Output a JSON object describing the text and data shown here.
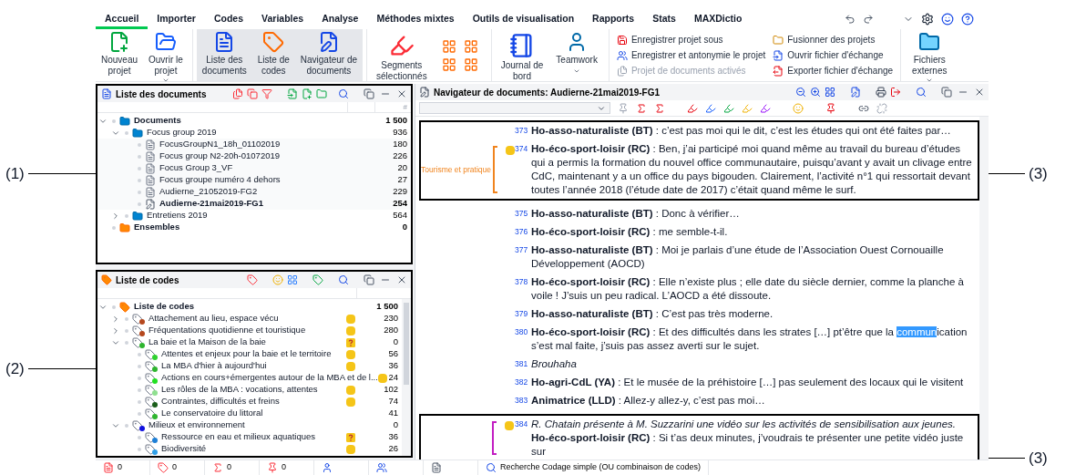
{
  "annotations": {
    "left": [
      {
        "label": "(1)"
      },
      {
        "label": "(2)"
      }
    ],
    "right": [
      {
        "label": "(3)"
      },
      {
        "label": "(3)"
      }
    ]
  },
  "tabs": [
    {
      "label": "Accueil",
      "selected": true
    },
    {
      "label": "Importer",
      "selected": false
    },
    {
      "label": "Codes",
      "selected": false
    },
    {
      "label": "Variables",
      "selected": false
    },
    {
      "label": "Analyse",
      "selected": false
    },
    {
      "label": "Méthodes mixtes",
      "selected": false
    },
    {
      "label": "Outils de visualisation",
      "selected": false
    },
    {
      "label": "Rapports",
      "selected": false
    },
    {
      "label": "Stats",
      "selected": false
    },
    {
      "label": "MAXDictio",
      "selected": false
    }
  ],
  "ribbon": {
    "project_buttons": [
      {
        "kind": "new",
        "lines": [
          "Nouveau",
          "projet"
        ]
      },
      {
        "kind": "open",
        "lines": [
          "Ouvrir le",
          "projet"
        ],
        "menu": true
      }
    ],
    "panel_buttons": [
      {
        "kind": "documents",
        "lines": [
          "Liste des",
          "documents"
        ],
        "selected": true
      },
      {
        "kind": "codes",
        "lines": [
          "Liste de",
          "codes"
        ],
        "selected": true
      },
      {
        "kind": "navigator",
        "lines": [
          "Navigateur de",
          "documents"
        ],
        "selected": true
      }
    ],
    "segments_button": {
      "lines": [
        "Segments",
        "sélectionnés"
      ]
    },
    "journal_button": {
      "lines": [
        "Journal de",
        "bord"
      ]
    },
    "teamwork_button": {
      "lines": [
        "Teamwork"
      ],
      "menu": true
    },
    "action_columns": [
      [
        {
          "kind": "save-as",
          "label": "Enregistrer projet sous",
          "disabled": false
        },
        {
          "kind": "anonymize",
          "label": "Enregistrer et antonymie le projet",
          "disabled": false
        },
        {
          "kind": "activated",
          "label": "Projet de documents activés",
          "disabled": true
        }
      ],
      [
        {
          "kind": "merge",
          "label": "Fusionner des projets",
          "disabled": false
        },
        {
          "kind": "open-exchange",
          "label": "Ouvrir fichier d'échange",
          "disabled": false
        },
        {
          "kind": "export",
          "label": "Exporter fichier d'échange",
          "disabled": false
        }
      ]
    ],
    "external_button": {
      "lines": [
        "Fichiers",
        "externes"
      ],
      "menu": true
    }
  },
  "documents_panel": {
    "title": "Liste des documents",
    "count_header": "#",
    "tree": [
      {
        "kind": "folder",
        "label": "Documents",
        "count": "1 500",
        "expanded": true,
        "children": [
          {
            "kind": "folder",
            "label": "Focus group 2019",
            "count": "936",
            "expanded": true,
            "children": [
              {
                "kind": "document",
                "label": "FocusGroupN1_18h_01102019",
                "count": "180",
                "active": false
              },
              {
                "kind": "document",
                "label": "Focus group N2-20h-01072019",
                "count": "226",
                "active": false
              },
              {
                "kind": "document",
                "label": "Focus Group 3_VF",
                "count": "20",
                "active": false
              },
              {
                "kind": "document",
                "label": "Focus groupe numéro 4 dehors",
                "count": "27",
                "active": false
              },
              {
                "kind": "document",
                "label": "Audierne_21052019-FG2",
                "count": "229",
                "active": false
              },
              {
                "kind": "document",
                "label": "Audierne-21mai2019-FG1",
                "count": "254",
                "active": true
              }
            ]
          },
          {
            "kind": "folder",
            "label": "Entretiens 2019",
            "count": "564",
            "expanded": false
          }
        ]
      },
      {
        "kind": "set",
        "label": "Ensembles",
        "count": "0"
      }
    ]
  },
  "codes_panel": {
    "title": "Liste de codes",
    "tree": [
      {
        "kind": "root",
        "label": "Liste de codes",
        "count": "1 500",
        "expanded": true,
        "children": [
          {
            "label": "Attachement au lieu, espace vécu",
            "count": "230",
            "color": "#b5481e",
            "memo": true,
            "question": false,
            "expanded": false
          },
          {
            "label": "Fréquentations quotidienne et touristique",
            "count": "280",
            "color": "#b5481e",
            "memo": true,
            "question": false,
            "expanded": false
          },
          {
            "label": "La baie et la Maison de la baie",
            "count": "0",
            "color": "#2fb52f",
            "memo": true,
            "question": true,
            "expanded": true,
            "children": [
              {
                "label": "Attentes et enjeux pour la baie et le territoire",
                "count": "56",
                "color": "#2fd12f",
                "memo": true,
                "question": false
              },
              {
                "label": "La MBA d'hier à aujourd'hui",
                "count": "36",
                "color": "#2fb52f",
                "memo": true,
                "question": false
              },
              {
                "label": "Actions en cours+émergentes autour de la MBA et de l...",
                "count": "24",
                "color": "#22e022",
                "memo": true,
                "question": false
              },
              {
                "label": "Les rôles de la MBA : vocations, attentes",
                "count": "102",
                "color": "#8fe08f",
                "memo": true,
                "question": false
              },
              {
                "label": "Contraintes, difficultés et freins",
                "count": "74",
                "color": "#1a5e1a",
                "memo": true,
                "question": false
              },
              {
                "label": "Le conservatoire du littoral",
                "count": "41",
                "color": "#2fb52f",
                "memo": false
              }
            ]
          },
          {
            "label": "Milieux et environnement",
            "count": "0",
            "color": "#1010e0",
            "memo": false,
            "expanded": true,
            "children": [
              {
                "label": "Ressource en eau et milieux aquatiques",
                "count": "36",
                "color": "#1e7fd6",
                "memo": true,
                "question": true
              },
              {
                "label": "Biodiversité",
                "count": "26",
                "color": "#2f9fe8",
                "memo": true,
                "question": false
              }
            ]
          }
        ]
      }
    ]
  },
  "navigator": {
    "title": "Navigateur de documents: Audierne-21mai2019-FG1",
    "blocks": [
      {
        "boxed": true,
        "paragraphs": [
          {
            "number": "373",
            "parts": [
              {
                "kind": "bold",
                "text": "Ho-asso-naturaliste (BT)"
              },
              {
                "kind": "plain",
                "text": " : c’est pas moi qui le dit, c’est les études qui ont été faites par…"
              }
            ]
          },
          {
            "number": "374",
            "memo": true,
            "coding": {
              "label": "Tourisme et pratique",
              "color": "#f0841e"
            },
            "parts": [
              {
                "kind": "bold",
                "text": "Ho-éco-sport-loisir (RC)"
              },
              {
                "kind": "plain",
                "text": " : Ben, j’ai participé moi quand même au travail du bureau d’études qui a permis la formation du nouvel office communautaire, puisqu’avant y avait un clivage entre CdC, maintenant y a un office du pays bigouden. Clairement, l’activité n°1 qui ressortait devant toutes l’année 2018 (l’étude date de 2017) c’était quand même le surf."
              }
            ]
          }
        ]
      },
      {
        "boxed": false,
        "paragraphs": [
          {
            "number": "375",
            "parts": [
              {
                "kind": "bold",
                "text": "Ho-asso-naturaliste (BT)"
              },
              {
                "kind": "plain",
                "text": " : Donc à vérifier…"
              }
            ]
          },
          {
            "number": "376",
            "parts": [
              {
                "kind": "bold",
                "text": "Ho-éco-sport-loisir (RC)"
              },
              {
                "kind": "plain",
                "text": " : me semble-t-il."
              }
            ]
          },
          {
            "number": "377",
            "parts": [
              {
                "kind": "bold",
                "text": "Ho-asso-naturaliste (BT)"
              },
              {
                "kind": "plain",
                "text": " : Moi je parlais d’une étude de l’Association Ouest Cornouaille Développement (AOCD)"
              }
            ]
          },
          {
            "number": "378",
            "parts": [
              {
                "kind": "bold",
                "text": "Ho-éco-sport-loisir (RC)"
              },
              {
                "kind": "plain",
                "text": " : Elle n’existe plus ; elle date du siècle dernier, comme la planche à voile ! J’suis un peu radical.  L’AOCD a été dissoute."
              }
            ]
          },
          {
            "number": "379",
            "parts": [
              {
                "kind": "bold",
                "text": "Ho-asso-naturaliste (BT)"
              },
              {
                "kind": "plain",
                "text": " : C’est pas très moderne."
              }
            ]
          },
          {
            "number": "380",
            "parts": [
              {
                "kind": "bold",
                "text": "Ho-éco-sport-loisir (RC)"
              },
              {
                "kind": "plain",
                "text": " : Et des difficultés dans les strates […] pt’être que la "
              },
              {
                "kind": "highlight",
                "text": "commun"
              },
              {
                "kind": "plain",
                "text": "ication s’est mal faite, j’suis pas assez averti sur le sujet."
              }
            ]
          },
          {
            "number": "381",
            "parts": [
              {
                "kind": "italic",
                "text": "Brouhaha"
              }
            ]
          },
          {
            "number": "382",
            "parts": [
              {
                "kind": "bold",
                "text": "Ho-agri-CdL (YA)"
              },
              {
                "kind": "plain",
                "text": " : Et le musée de la préhistoire […] pas seulement des locaux qui le visitent"
              }
            ]
          },
          {
            "number": "383",
            "parts": [
              {
                "kind": "bold",
                "text": "Animatrice (LLD)"
              },
              {
                "kind": "plain",
                "text": " : Allez-y allez-y, c’est pas moi…"
              }
            ]
          }
        ]
      },
      {
        "boxed": true,
        "paragraphs": [
          {
            "number": "384",
            "memo": true,
            "coding": {
              "color": "#c21ec2"
            },
            "parts": [
              {
                "kind": "italic",
                "text": "R. Chatain présente à M. Suzzarini une vidéo sur les activités de sensibilisation aux jeunes. "
              },
              {
                "kind": "bold",
                "text": "Ho-éco-sport-loisir (RC)"
              },
              {
                "kind": "plain",
                "text": " : Si t’as deux minutes, j’voudrais te présenter une petite vidéo juste sur"
              }
            ]
          }
        ]
      }
    ]
  },
  "status_bar": [
    {
      "kind": "documents",
      "count": "0"
    },
    {
      "kind": "codes",
      "count": "0"
    },
    {
      "kind": "segments",
      "count": "0"
    },
    {
      "kind": "variables",
      "count": "0"
    },
    {
      "kind": "user"
    },
    {
      "kind": "users"
    },
    {
      "kind": "page"
    },
    {
      "kind": "search",
      "label": "Recherche Codage simple (OU combinaison de codes)"
    }
  ]
}
